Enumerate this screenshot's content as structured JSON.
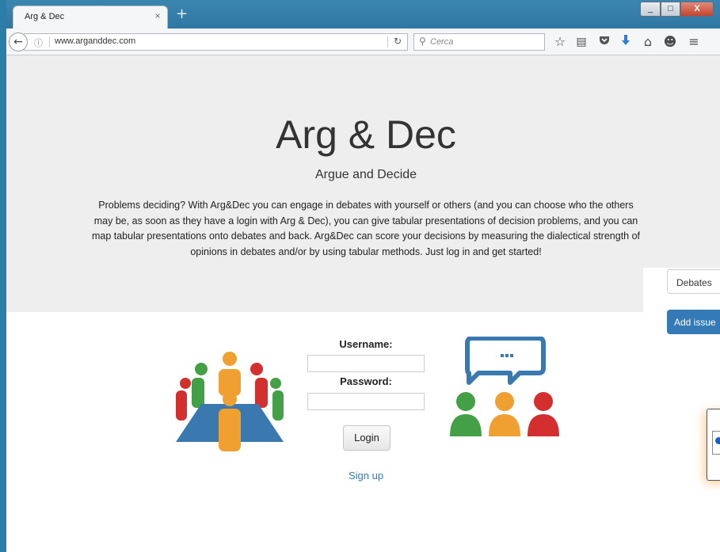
{
  "browser": {
    "tab_title": "Arg & Dec",
    "tab_close": "×",
    "new_tab": "+",
    "window_minimize": "_",
    "window_maximize": "□",
    "window_close": "X",
    "url": "www.arganddec.com",
    "search_placeholder": "Cerca",
    "toolbar_icons": [
      "bookmark-star-icon",
      "reading-list-icon",
      "pocket-icon",
      "download-icon",
      "home-icon",
      "smiley-icon",
      "menu-icon"
    ]
  },
  "hero": {
    "title": "Arg & Dec",
    "subtitle": "Argue and Decide",
    "description": "Problems deciding? With Arg&Dec you can engage in debates with yourself or others (and you can choose who the others may be, as soon as they have a login with Arg & Dec), you can give tabular presentations of decision problems, and you can map tabular presentations onto debates and back. Arg&Dec can score your decisions by measuring the dialectical strength of opinions in debates and/or by using tabular methods. Just log in and get started!"
  },
  "login": {
    "username_label": "Username:",
    "password_label": "Password:",
    "username_value": "",
    "password_value": "",
    "login_button": "Login",
    "signup_link": "Sign up"
  },
  "side_panel": {
    "debates_button": "Debates",
    "add_issue_button": "Add issue"
  },
  "colors": {
    "accent_blue": "#337ab7",
    "orange": "#f0a030",
    "green": "#43a047",
    "red": "#d32f2f",
    "table_blue": "#3a78b0",
    "hero_bg": "#eeeeee"
  }
}
